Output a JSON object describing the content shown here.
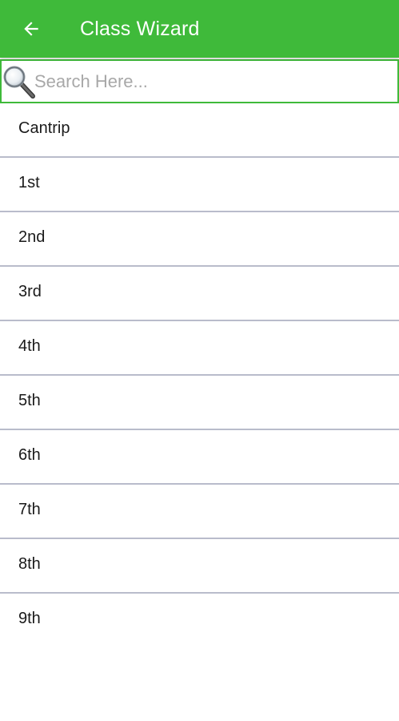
{
  "colors": {
    "app_bar": "#3fba3a",
    "divider": "#b9bccb",
    "search_border": "#3fba3a"
  },
  "header": {
    "back_icon": "arrow-left-icon",
    "title": "Class Wizard"
  },
  "search": {
    "icon": "magnifier-icon",
    "placeholder": "Search Here...",
    "value": ""
  },
  "list": {
    "items": [
      {
        "label": "Cantrip"
      },
      {
        "label": "1st"
      },
      {
        "label": "2nd"
      },
      {
        "label": "3rd"
      },
      {
        "label": "4th"
      },
      {
        "label": "5th"
      },
      {
        "label": "6th"
      },
      {
        "label": "7th"
      },
      {
        "label": "8th"
      },
      {
        "label": "9th"
      }
    ]
  }
}
